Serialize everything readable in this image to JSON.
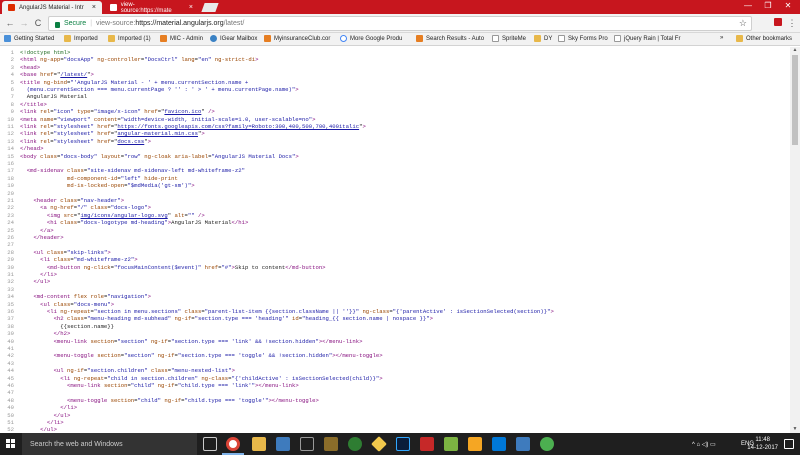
{
  "tabs": [
    {
      "title": "AngularJS Material - Intr",
      "close": "×"
    },
    {
      "title": "view-source:https://mate",
      "close": "×"
    }
  ],
  "window_controls": {
    "minimize": "—",
    "restore": "❐",
    "close": "✕"
  },
  "toolbar": {
    "back": "←",
    "forward": "→",
    "reload": "C",
    "secure_label": "Secure",
    "url_prefix": "view-source:",
    "url_host": "https://material.angularjs.org",
    "url_path": "/latest/",
    "star": "☆",
    "menu": "⋮"
  },
  "bookmarks": {
    "items": [
      {
        "label": "Getting Started"
      },
      {
        "label": "Imported"
      },
      {
        "label": "Imported (1)"
      },
      {
        "label": "MIC - Admin"
      },
      {
        "label": "IGear Mailbox"
      },
      {
        "label": "MyinsuranceClub.cor"
      },
      {
        "label": "More Google Produ"
      },
      {
        "label": "Search Results - Auto"
      },
      {
        "label": "SpriteMe"
      },
      {
        "label": "DY"
      },
      {
        "label": "Sky Forms Pro"
      },
      {
        "label": "jQuery Rain | Total Fr"
      }
    ],
    "overflow": "»",
    "other": "Other bookmarks"
  },
  "source_lines": [
    {
      "n": "1",
      "html": "<span class='cmt'>&lt;!doctype html&gt;</span>"
    },
    {
      "n": "2",
      "html": "<span class='tag'>&lt;html</span> <span class='attr'>ng-app</span>=<span class='val'>\"docsApp\"</span> <span class='attr'>ng-controller</span>=<span class='val'>\"DocsCtrl\"</span> <span class='attr'>lang</span>=<span class='val'>\"en\"</span> <span class='attr'>ng-strict-di</span><span class='tag'>&gt;</span>"
    },
    {
      "n": "3",
      "html": "<span class='tag'>&lt;head&gt;</span>"
    },
    {
      "n": "4",
      "html": "<span class='tag'>&lt;base</span> <span class='attr'>href</span>=\"<span class='link'>/latest/</span>\"<span class='tag'>&gt;</span>"
    },
    {
      "n": "5",
      "html": "<span class='tag'>&lt;title</span> <span class='attr'>ng-bind</span>=<span class='val'>\"'AngularJS Material - ' + menu.currentSection.name +</span>"
    },
    {
      "n": "6",
      "html": "<span class='val'>  (menu.currentSection === menu.currentPage ? '' : ' &gt; ' + menu.currentPage.name)\"</span><span class='tag'>&gt;</span>"
    },
    {
      "n": "7",
      "html": "  AngularJS Material"
    },
    {
      "n": "8",
      "html": "<span class='tag'>&lt;/title&gt;</span>"
    },
    {
      "n": "9",
      "html": "<span class='tag'>&lt;link</span> <span class='attr'>rel</span>=<span class='val'>\"icon\"</span> <span class='attr'>type</span>=<span class='val'>\"image/x-icon\"</span> <span class='attr'>href</span>=\"<span class='link'>favicon.ico</span>\" <span class='tag'>/&gt;</span>"
    },
    {
      "n": "10",
      "html": "<span class='tag'>&lt;meta</span> <span class='attr'>name</span>=<span class='val'>\"viewport\"</span> <span class='attr'>content</span>=<span class='val'>\"width=device-width, initial-scale=1.0, user-scalable=no\"</span><span class='tag'>&gt;</span>"
    },
    {
      "n": "11",
      "html": "<span class='tag'>&lt;link</span> <span class='attr'>rel</span>=<span class='val'>\"stylesheet\"</span> <span class='attr'>href</span>=\"<span class='link'>https://fonts.googleapis.com/css?family=Roboto:300,400,500,700,400italic</span>\"<span class='tag'>&gt;</span>"
    },
    {
      "n": "12",
      "html": "<span class='tag'>&lt;link</span> <span class='attr'>rel</span>=<span class='val'>\"stylesheet\"</span> <span class='attr'>href</span>=\"<span class='link'>angular-material.min.css</span>\"<span class='tag'>&gt;</span>"
    },
    {
      "n": "13",
      "html": "<span class='tag'>&lt;link</span> <span class='attr'>rel</span>=<span class='val'>\"stylesheet\"</span> <span class='attr'>href</span>=\"<span class='link'>docs.css</span>\"<span class='tag'>&gt;</span>"
    },
    {
      "n": "14",
      "html": "<span class='tag'>&lt;/head&gt;</span>"
    },
    {
      "n": "15",
      "html": "<span class='tag'>&lt;body</span> <span class='attr'>class</span>=<span class='val'>\"docs-body\"</span> <span class='attr'>layout</span>=<span class='val'>\"row\"</span> <span class='attr'>ng-cloak</span> <span class='attr'>aria-label</span>=<span class='val'>\"AngularJS Material Docs\"</span><span class='tag'>&gt;</span>"
    },
    {
      "n": "16",
      "html": ""
    },
    {
      "n": "17",
      "html": "  <span class='tag'>&lt;md-sidenav</span> <span class='attr'>class</span>=<span class='val'>\"site-sidenav md-sidenav-left md-whiteframe-z2\"</span>"
    },
    {
      "n": "18",
      "html": "              <span class='attr'>md-component-id</span>=<span class='val'>\"left\"</span> <span class='attr'>hide-print</span>"
    },
    {
      "n": "19",
      "html": "              <span class='attr'>md-is-locked-open</span>=<span class='val'>\"$mdMedia('gt-sm')\"</span><span class='tag'>&gt;</span>"
    },
    {
      "n": "20",
      "html": ""
    },
    {
      "n": "21",
      "html": "    <span class='tag'>&lt;header</span> <span class='attr'>class</span>=<span class='val'>\"nav-header\"</span><span class='tag'>&gt;</span>"
    },
    {
      "n": "22",
      "html": "      <span class='tag'>&lt;a</span> <span class='attr'>ng-href</span>=<span class='val'>\"/\"</span> <span class='attr'>class</span>=<span class='val'>\"docs-logo\"</span><span class='tag'>&gt;</span>"
    },
    {
      "n": "23",
      "html": "        <span class='tag'>&lt;img</span> <span class='attr'>src</span>=\"<span class='link'>img/icons/angular-logo.svg</span>\" <span class='attr'>alt</span>=<span class='val'>\"\"</span> <span class='tag'>/&gt;</span>"
    },
    {
      "n": "24",
      "html": "        <span class='tag'>&lt;h1</span> <span class='attr'>class</span>=<span class='val'>\"docs-logotype md-heading\"</span><span class='tag'>&gt;</span>AngularJS Material<span class='tag'>&lt;/h1&gt;</span>"
    },
    {
      "n": "25",
      "html": "      <span class='tag'>&lt;/a&gt;</span>"
    },
    {
      "n": "26",
      "html": "    <span class='tag'>&lt;/header&gt;</span>"
    },
    {
      "n": "27",
      "html": ""
    },
    {
      "n": "28",
      "html": "    <span class='tag'>&lt;ul</span> <span class='attr'>class</span>=<span class='val'>\"skip-links\"</span><span class='tag'>&gt;</span>"
    },
    {
      "n": "29",
      "html": "      <span class='tag'>&lt;li</span> <span class='attr'>class</span>=<span class='val'>\"md-whiteframe-z2\"</span><span class='tag'>&gt;</span>"
    },
    {
      "n": "30",
      "html": "        <span class='tag'>&lt;md-button</span> <span class='attr'>ng-click</span>=<span class='val'>\"focusMainContent($event)\"</span> <span class='attr'>href</span>=<span class='val'>\"#\"</span><span class='tag'>&gt;</span>Skip to content<span class='tag'>&lt;/md-button&gt;</span>"
    },
    {
      "n": "31",
      "html": "      <span class='tag'>&lt;/li&gt;</span>"
    },
    {
      "n": "32",
      "html": "    <span class='tag'>&lt;/ul&gt;</span>"
    },
    {
      "n": "33",
      "html": ""
    },
    {
      "n": "34",
      "html": "    <span class='tag'>&lt;md-content</span> <span class='attr'>flex</span> <span class='attr'>role</span>=<span class='val'>\"navigation\"</span><span class='tag'>&gt;</span>"
    },
    {
      "n": "35",
      "html": "      <span class='tag'>&lt;ul</span> <span class='attr'>class</span>=<span class='val'>\"docs-menu\"</span><span class='tag'>&gt;</span>"
    },
    {
      "n": "36",
      "html": "        <span class='tag'>&lt;li</span> <span class='attr'>ng-repeat</span>=<span class='val'>\"section in menu.sections\"</span> <span class='attr'>class</span>=<span class='val'>\"parent-list-item {{section.className || ''}}\"</span> <span class='attr'>ng-class</span>=<span class='val'>\"{'parentActive' : isSectionSelected(section)}\"</span><span class='tag'>&gt;</span>"
    },
    {
      "n": "37",
      "html": "          <span class='tag'>&lt;h2</span> <span class='attr'>class</span>=<span class='val'>\"menu-heading md-subhead\"</span> <span class='attr'>ng-if</span>=<span class='val'>\"section.type === 'heading'\"</span> <span class='attr'>id</span>=<span class='val'>\"heading_{{ section.name | nospace }}\"</span><span class='tag'>&gt;</span>"
    },
    {
      "n": "38",
      "html": "            {{section.name}}"
    },
    {
      "n": "39",
      "html": "          <span class='tag'>&lt;/h2&gt;</span>"
    },
    {
      "n": "40",
      "html": "          <span class='tag'>&lt;menu-link</span> <span class='attr'>section</span>=<span class='val'>\"section\"</span> <span class='attr'>ng-if</span>=<span class='val'>\"section.type === 'link' &amp;&amp; !section.hidden\"</span><span class='tag'>&gt;&lt;/menu-link&gt;</span>"
    },
    {
      "n": "41",
      "html": ""
    },
    {
      "n": "42",
      "html": "          <span class='tag'>&lt;menu-toggle</span> <span class='attr'>section</span>=<span class='val'>\"section\"</span> <span class='attr'>ng-if</span>=<span class='val'>\"section.type === 'toggle' &amp;&amp; !section.hidden\"</span><span class='tag'>&gt;&lt;/menu-toggle&gt;</span>"
    },
    {
      "n": "43",
      "html": ""
    },
    {
      "n": "44",
      "html": "          <span class='tag'>&lt;ul</span> <span class='attr'>ng-if</span>=<span class='val'>\"section.children\"</span> <span class='attr'>class</span>=<span class='val'>\"menu-nested-list\"</span><span class='tag'>&gt;</span>"
    },
    {
      "n": "45",
      "html": "            <span class='tag'>&lt;li</span> <span class='attr'>ng-repeat</span>=<span class='val'>\"child in section.children\"</span> <span class='attr'>ng-class</span>=<span class='val'>\"{'childActive' : isSectionSelected(child)}\"</span><span class='tag'>&gt;</span>"
    },
    {
      "n": "46",
      "html": "              <span class='tag'>&lt;menu-link</span> <span class='attr'>section</span>=<span class='val'>\"child\"</span> <span class='attr'>ng-if</span>=<span class='val'>\"child.type === 'link'\"</span><span class='tag'>&gt;&lt;/menu-link&gt;</span>"
    },
    {
      "n": "47",
      "html": ""
    },
    {
      "n": "48",
      "html": "              <span class='tag'>&lt;menu-toggle</span> <span class='attr'>section</span>=<span class='val'>\"child\"</span> <span class='attr'>ng-if</span>=<span class='val'>\"child.type === 'toggle'\"</span><span class='tag'>&gt;&lt;/menu-toggle&gt;</span>"
    },
    {
      "n": "49",
      "html": "            <span class='tag'>&lt;/li&gt;</span>"
    },
    {
      "n": "50",
      "html": "          <span class='tag'>&lt;/ul&gt;</span>"
    },
    {
      "n": "51",
      "html": "        <span class='tag'>&lt;/li&gt;</span>"
    },
    {
      "n": "52",
      "html": "      <span class='tag'>&lt;/ul&gt;</span>"
    }
  ],
  "taskbar": {
    "search_placeholder": "Search the web and Windows",
    "language": "ENG",
    "time": "11:48",
    "date": "14-12-2017",
    "tray_symbols": "^  ⌂  ◁)  ▭"
  }
}
